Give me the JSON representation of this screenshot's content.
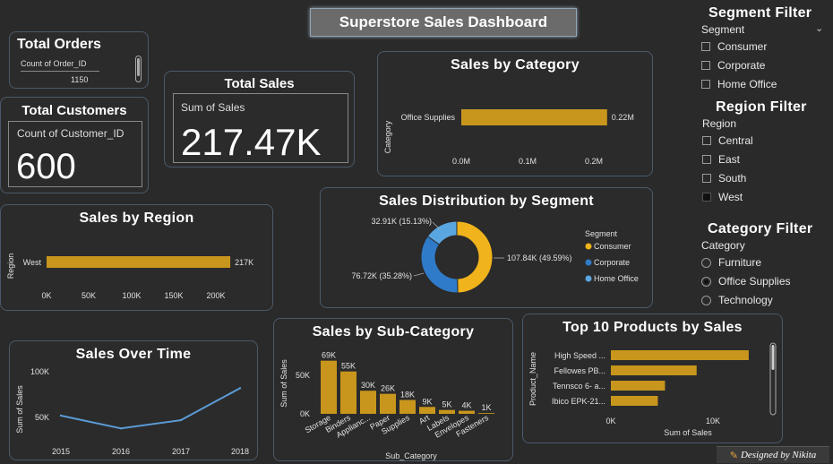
{
  "dashboard_title": "Superstore Sales Dashboard",
  "colors": {
    "bar": "#c8961c",
    "line": "#5b9bd5",
    "consumer": "#f1b31c",
    "corporate": "#2f7bc9",
    "home_office": "#5aa6e0",
    "background": "#2a2a2a"
  },
  "total_orders": {
    "title": "Total Orders",
    "label": "Count of Order_ID",
    "value": "1150"
  },
  "total_customers": {
    "title": "Total Customers",
    "label": "Count of Customer_ID",
    "value": "600"
  },
  "total_sales": {
    "title": "Total Sales",
    "label": "Sum of Sales",
    "value": "217.47K"
  },
  "segment_filter": {
    "title": "Segment Filter",
    "header": "Segment",
    "options": [
      {
        "label": "Consumer",
        "checked": false
      },
      {
        "label": "Corporate",
        "checked": false
      },
      {
        "label": "Home Office",
        "checked": false
      }
    ]
  },
  "region_filter": {
    "title": "Region Filter",
    "header": "Region",
    "options": [
      {
        "label": "Central",
        "checked": false
      },
      {
        "label": "East",
        "checked": false
      },
      {
        "label": "South",
        "checked": false
      },
      {
        "label": "West",
        "checked": true
      }
    ]
  },
  "category_filter": {
    "title": "Category Filter",
    "header": "Category",
    "options": [
      {
        "label": "Furniture",
        "selected": false
      },
      {
        "label": "Office Supplies",
        "selected": true
      },
      {
        "label": "Technology",
        "selected": false
      }
    ]
  },
  "footer": "Designed by Nikita",
  "chart_data": [
    {
      "id": "category",
      "type": "bar",
      "orientation": "horizontal",
      "title": "Sales by Category",
      "ylabel": "Category",
      "categories": [
        "Office Supplies"
      ],
      "values": [
        0.22
      ],
      "data_labels": [
        "0.22M"
      ],
      "xticks": [
        "0.0M",
        "0.1M",
        "0.2M"
      ],
      "xlim": [
        0,
        0.25
      ]
    },
    {
      "id": "region",
      "type": "bar",
      "orientation": "horizontal",
      "title": "Sales by Region",
      "ylabel": "Region",
      "categories": [
        "West"
      ],
      "values": [
        217
      ],
      "data_labels": [
        "217K"
      ],
      "xticks": [
        "0K",
        "50K",
        "100K",
        "150K",
        "200K"
      ],
      "xlim": [
        0,
        230
      ]
    },
    {
      "id": "segment",
      "type": "pie",
      "donut": true,
      "title": "Sales Distribution by Segment",
      "legend_title": "Segment",
      "slices": [
        {
          "name": "Consumer",
          "value": 107.84,
          "label": "107.84K (49.59%)"
        },
        {
          "name": "Corporate",
          "value": 76.72,
          "label": "76.72K (35.28%)"
        },
        {
          "name": "Home Office",
          "value": 32.91,
          "label": "32.91K (15.13%)"
        }
      ]
    },
    {
      "id": "time",
      "type": "line",
      "title": "Sales Over Time",
      "ylabel": "Sum of Sales",
      "x": [
        "2015",
        "2016",
        "2017",
        "2018"
      ],
      "values": [
        52,
        38,
        47,
        82
      ],
      "yticks": [
        "50K",
        "100K"
      ],
      "ylim": [
        30,
        105
      ]
    },
    {
      "id": "subcategory",
      "type": "bar",
      "title": "Sales by Sub-Category",
      "xlabel": "Sub_Category",
      "ylabel": "Sum of Sales",
      "categories": [
        "Storage",
        "Binders",
        "Applianc...",
        "Paper",
        "Supplies",
        "Art",
        "Labels",
        "Envelopes",
        "Fasteners"
      ],
      "values": [
        69,
        55,
        30,
        26,
        18,
        9,
        5,
        4,
        1
      ],
      "data_labels": [
        "69K",
        "55K",
        "30K",
        "26K",
        "18K",
        "9K",
        "5K",
        "4K",
        "1K"
      ],
      "yticks": [
        "0K",
        "50K"
      ],
      "ylim": [
        0,
        75
      ]
    },
    {
      "id": "products",
      "type": "bar",
      "orientation": "horizontal",
      "title": "Top 10 Products by Sales",
      "xlabel": "Sum of Sales",
      "ylabel": "Product_Name",
      "categories": [
        "High Speed ...",
        "Fellowes PB...",
        "Tennsco 6- a...",
        "Ibico EPK-21..."
      ],
      "values": [
        13.5,
        8.4,
        5.3,
        4.6
      ],
      "xticks": [
        "0K",
        "10K"
      ],
      "xlim": [
        0,
        14
      ]
    }
  ]
}
